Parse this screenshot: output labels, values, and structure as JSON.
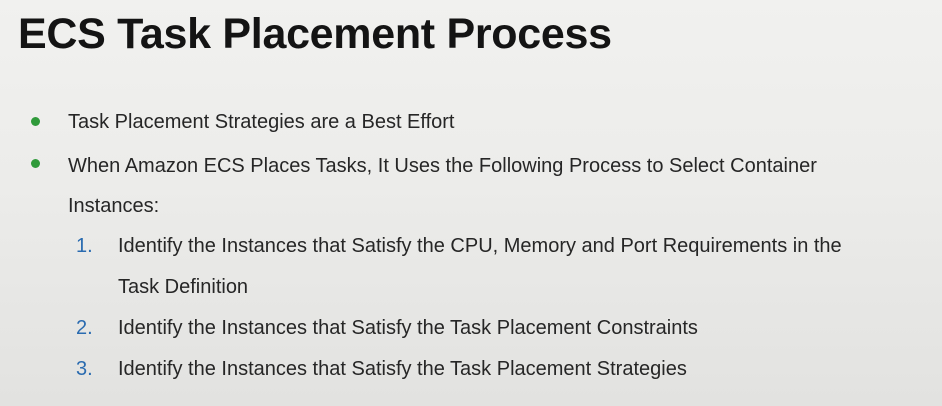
{
  "title": "ECS Task Placement Process",
  "bullets": [
    {
      "lines": [
        "Task Placement Strategies are a Best Effort"
      ]
    },
    {
      "lines": [
        "When Amazon ECS Places Tasks, It Uses the Following Process to Select Container",
        "Instances:"
      ],
      "steps": [
        {
          "marker": "1.",
          "lines": [
            "Identify the Instances that Satisfy the CPU, Memory and Port Requirements in the",
            "Task Definition"
          ]
        },
        {
          "marker": "2.",
          "lines": [
            "Identify the Instances that Satisfy the Task Placement Constraints"
          ]
        },
        {
          "marker": "3.",
          "lines": [
            "Identify the Instances that Satisfy the Task Placement Strategies"
          ]
        }
      ]
    }
  ],
  "colors": {
    "bullet": "#2f9a3a",
    "number": "#2a6bb0"
  }
}
